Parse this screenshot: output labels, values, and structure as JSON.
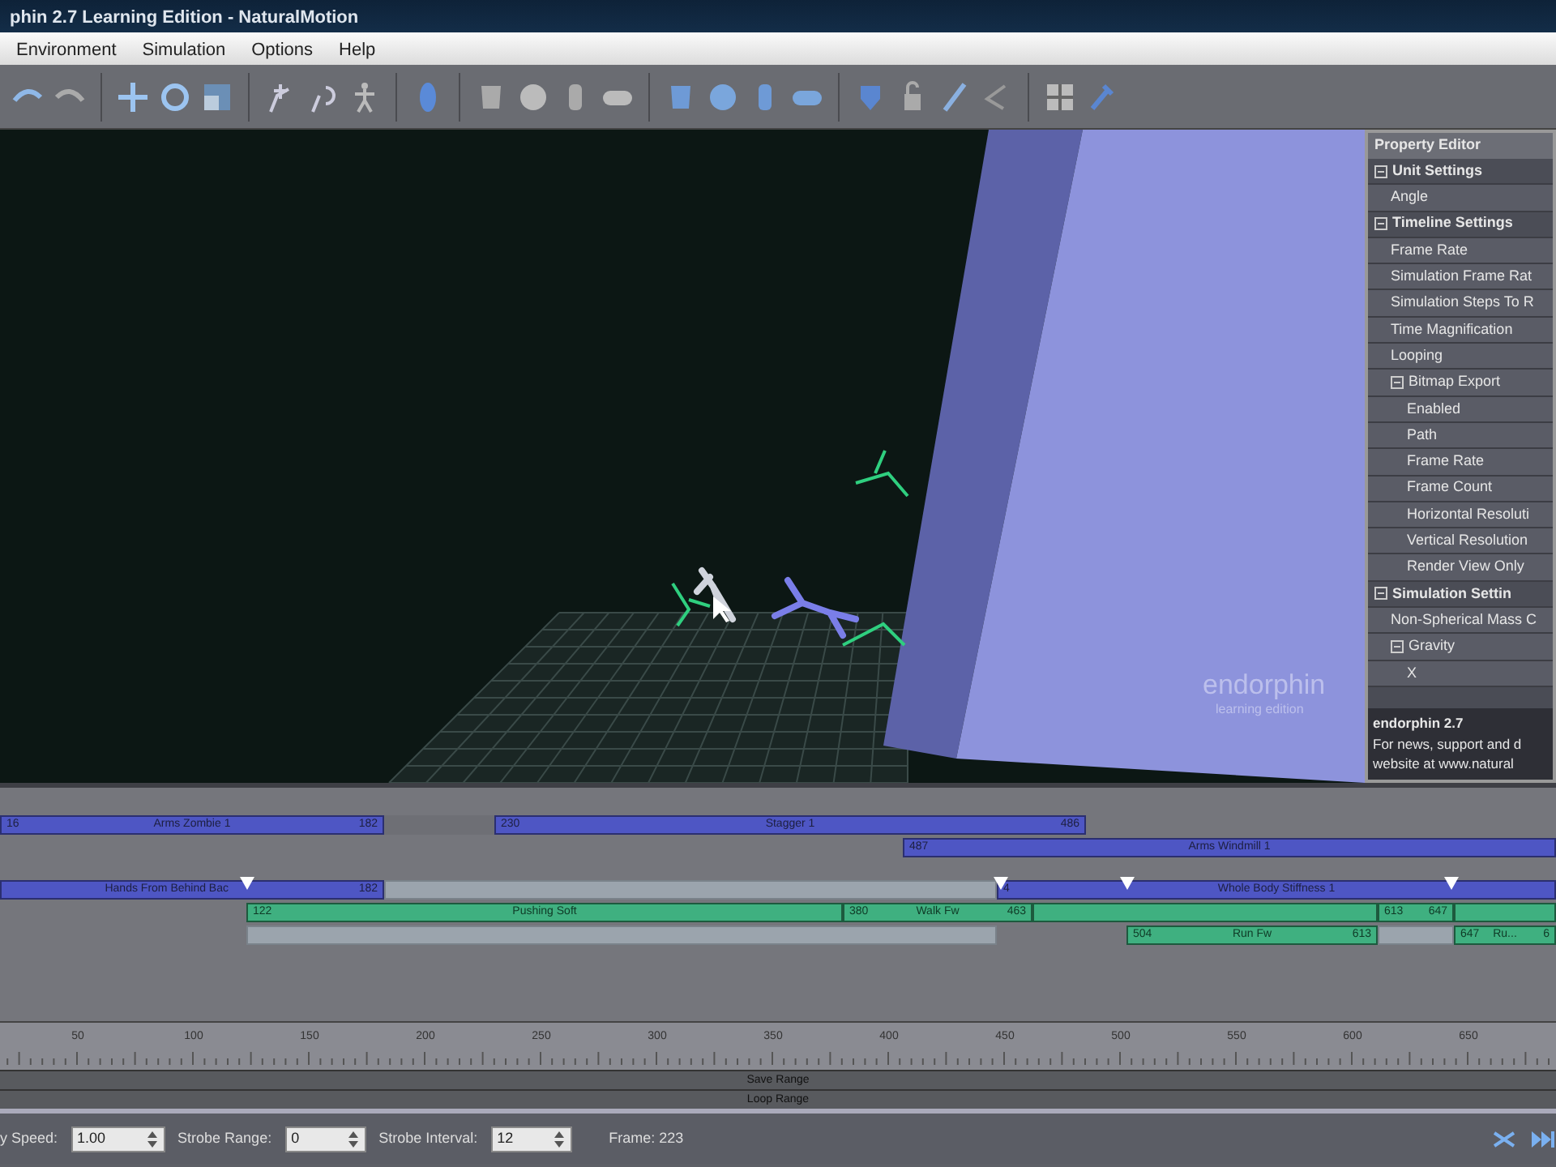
{
  "window": {
    "title": "phin 2.7 Learning Edition - NaturalMotion"
  },
  "menu": [
    "Environment",
    "Simulation",
    "Options",
    "Help"
  ],
  "viewport": {
    "watermark_title": "endorphin",
    "watermark_subtitle": "learning edition"
  },
  "property_editor": {
    "title": "Property Editor",
    "rows": [
      {
        "kind": "group",
        "label": "Unit Settings",
        "expanded": true,
        "children": [
          {
            "kind": "item",
            "label": "Angle"
          }
        ]
      },
      {
        "kind": "group",
        "label": "Timeline Settings",
        "expanded": true,
        "children": [
          {
            "kind": "item",
            "label": "Frame Rate"
          },
          {
            "kind": "item",
            "label": "Simulation Frame Rat"
          },
          {
            "kind": "item",
            "label": "Simulation Steps To R"
          },
          {
            "kind": "item",
            "label": "Time Magnification"
          },
          {
            "kind": "item",
            "label": "Looping"
          },
          {
            "kind": "group",
            "label": "Bitmap Export",
            "expanded": true,
            "children": [
              {
                "kind": "item",
                "label": "Enabled"
              },
              {
                "kind": "item",
                "label": "Path"
              },
              {
                "kind": "item",
                "label": "Frame Rate"
              },
              {
                "kind": "item",
                "label": "Frame Count"
              },
              {
                "kind": "item",
                "label": "Horizontal Resoluti"
              },
              {
                "kind": "item",
                "label": "Vertical Resolution"
              },
              {
                "kind": "item",
                "label": "Render View Only"
              }
            ]
          }
        ]
      },
      {
        "kind": "group",
        "label": "Simulation Settin",
        "expanded": true,
        "children": [
          {
            "kind": "item",
            "label": "Non-Spherical Mass C"
          },
          {
            "kind": "group",
            "label": "Gravity",
            "expanded": true,
            "children": [
              {
                "kind": "item",
                "label": "X"
              }
            ]
          }
        ]
      }
    ],
    "footer_title": "endorphin 2.7",
    "footer_text": [
      "For news, support and d",
      "website at www.natural"
    ]
  },
  "timeline": {
    "tracks": [
      {
        "clips": [
          {
            "kind": "action",
            "start": "16",
            "label": "Arms Zombie 1",
            "end": "182"
          },
          {
            "kind": "empty"
          },
          {
            "kind": "action",
            "start": "230",
            "label": "Stagger 1",
            "end": "486"
          }
        ]
      },
      {
        "clips": [
          {
            "kind": "action",
            "start": "487",
            "label": "Arms Windmill 1"
          }
        ]
      },
      {
        "clips": [
          {
            "kind": "action",
            "label": "Hands From Behind Bac",
            "end": "182"
          },
          {
            "kind": "gap"
          },
          {
            "kind": "action",
            "start": "4",
            "label": "Whole Body Stiffness 1"
          }
        ]
      },
      {
        "clips": [
          {
            "kind": "blend",
            "start": "122",
            "label": "Pushing Soft"
          },
          {
            "kind": "blend",
            "start": "380",
            "label": "Walk Fw",
            "end": "463"
          },
          {
            "kind": "blend"
          },
          {
            "kind": "blend",
            "start": "613",
            "end": "647"
          },
          {
            "kind": "blend"
          }
        ]
      },
      {
        "clips": [
          {
            "kind": "gap"
          },
          {
            "kind": "blend",
            "start": "504",
            "label": "Run Fw",
            "end": "613"
          },
          {
            "kind": "gap"
          },
          {
            "kind": "blend",
            "start": "647",
            "label": "Ru...",
            "end": "6"
          }
        ]
      }
    ],
    "ruler": [
      "50",
      "100",
      "150",
      "200",
      "250",
      "300",
      "350",
      "400",
      "450",
      "500",
      "550",
      "600",
      "650"
    ],
    "save_range": "Save Range",
    "loop_range": "Loop Range"
  },
  "controls": {
    "speed_label": "y Speed:",
    "speed": "1.00",
    "strobe_range_label": "Strobe Range:",
    "strobe_range": "0",
    "strobe_interval_label": "Strobe Interval:",
    "strobe_interval": "12",
    "frame": "Frame: 223"
  }
}
